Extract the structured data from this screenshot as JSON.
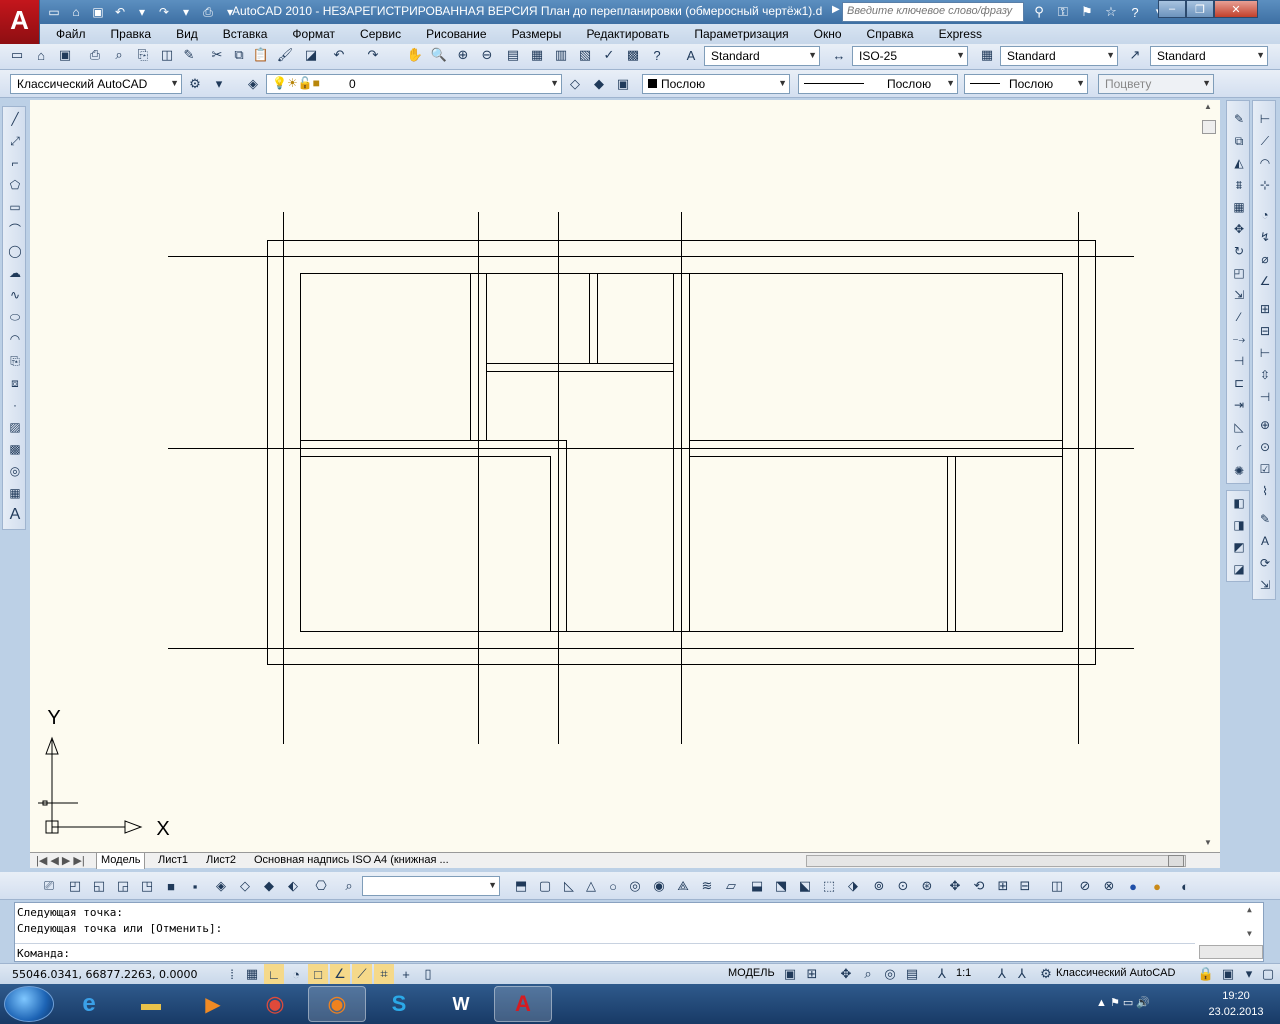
{
  "window": {
    "title": "AutoCAD 2010 - НЕЗАРЕГИСТРИРОВАННАЯ ВЕРСИЯ    План до перепланировки (обмеросный чертёж1).d",
    "search_placeholder": "Введите ключевое слово/фразу",
    "logo": "A"
  },
  "menu": [
    "Файл",
    "Правка",
    "Вид",
    "Вставка",
    "Формат",
    "Сервис",
    "Рисование",
    "Размеры",
    "Редактировать",
    "Параметризация",
    "Окно",
    "Справка",
    "Express"
  ],
  "toolbar_styles": {
    "text_style": "Standard",
    "dim_style": "ISO-25",
    "table_style": "Standard",
    "mleader_style": "Standard"
  },
  "toolbar_layers": {
    "workspace": "Классический AutoCAD",
    "layer": "0",
    "color": "Послою",
    "linetype": "Послою",
    "lineweight": "Послою",
    "plotstyle": "Поцвету"
  },
  "axis": {
    "y_label": "Y",
    "x_label": "X"
  },
  "tabs": [
    "Модель",
    "Лист1",
    "Лист2",
    "Основная надпись ISO A4 (книжная ..."
  ],
  "command": {
    "line1": "Следующая точка:",
    "line2": "Следующая точка или [Отменить]:",
    "prompt": "Команда:"
  },
  "status": {
    "coordinates": "55046.0341, 66877.2263, 0.0000",
    "model_label": "МОДЕЛЬ",
    "scale": "1:1",
    "workspace": "Классический AutoCAD"
  },
  "taskbar": {
    "time": "19:20",
    "date": "23.02.2013",
    "apps": [
      "internet-explorer",
      "file-explorer",
      "media-player",
      "chrome",
      "firefox",
      "skype",
      "word",
      "autocad"
    ]
  },
  "colors": {
    "canvas": "#fdfbf0",
    "titlebar": "#4a7bb0",
    "logo_red": "#c4161c"
  }
}
